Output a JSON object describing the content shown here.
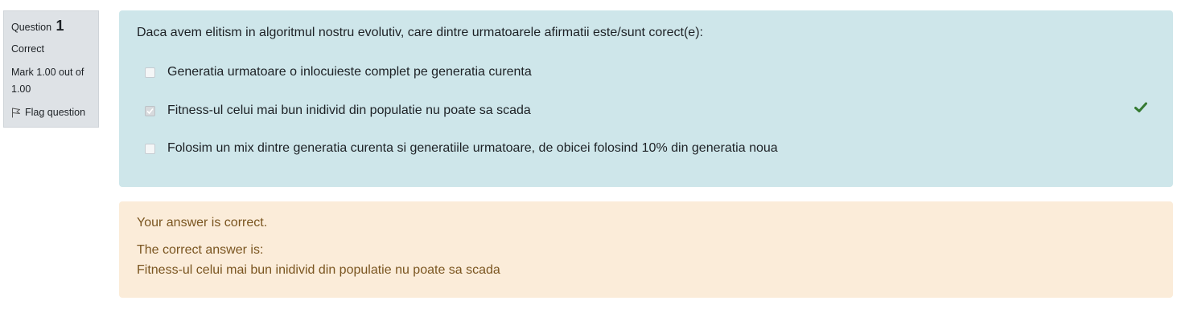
{
  "info": {
    "question_label": "Question",
    "question_number": "1",
    "state": "Correct",
    "grade": "Mark 1.00 out of 1.00",
    "flag_label": "Flag question"
  },
  "question": {
    "text": "Daca avem elitism in algoritmul nostru evolutiv, care dintre urmatoarele afirmatii este/sunt corect(e):",
    "options": [
      {
        "label": "Generatia urmatoare o inlocuieste complet pe generatia curenta",
        "checked": false
      },
      {
        "label": "Fitness-ul celui mai bun inidivid din populatie nu poate sa scada",
        "checked": true,
        "correct": true
      },
      {
        "label": "Folosim un mix dintre generatia curenta si generatiile urmatoare, de obicei folosind 10% din generatia noua",
        "checked": false
      }
    ]
  },
  "feedback": {
    "general": "Your answer is correct.",
    "right_answer_label": "The correct answer is:",
    "right_answer": "Fitness-ul celui mai bun inidivid din populatie nu poate sa scada"
  },
  "colors": {
    "formulation_bg": "#cee6ea",
    "outcome_bg": "#fbecd9",
    "correct_mark": "#357a32"
  },
  "icons": {
    "flag": "flag-icon",
    "correct": "check-icon"
  }
}
